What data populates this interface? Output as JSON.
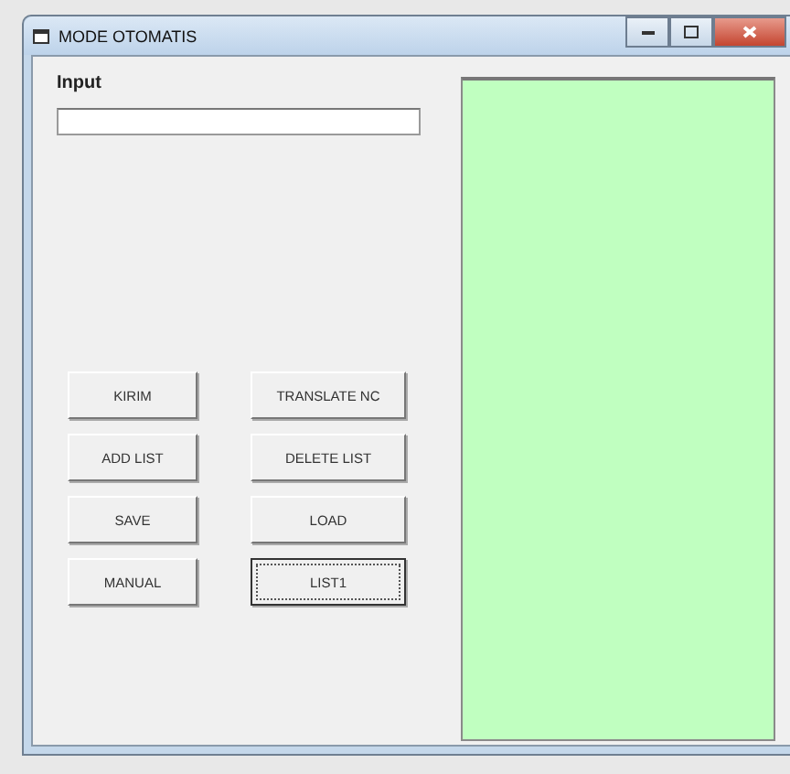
{
  "window": {
    "title": "MODE OTOMATIS"
  },
  "input": {
    "label": "Input"
  },
  "buttons": [
    {
      "label": "KIRIM",
      "focused": false
    },
    {
      "label": "TRANSLATE NC",
      "focused": false
    },
    {
      "label": "ADD LIST",
      "focused": false
    },
    {
      "label": "DELETE LIST",
      "focused": false
    },
    {
      "label": "SAVE",
      "focused": false
    },
    {
      "label": "LOAD",
      "focused": false
    },
    {
      "label": "MANUAL",
      "focused": false
    },
    {
      "label": "LIST1",
      "focused": true
    }
  ]
}
